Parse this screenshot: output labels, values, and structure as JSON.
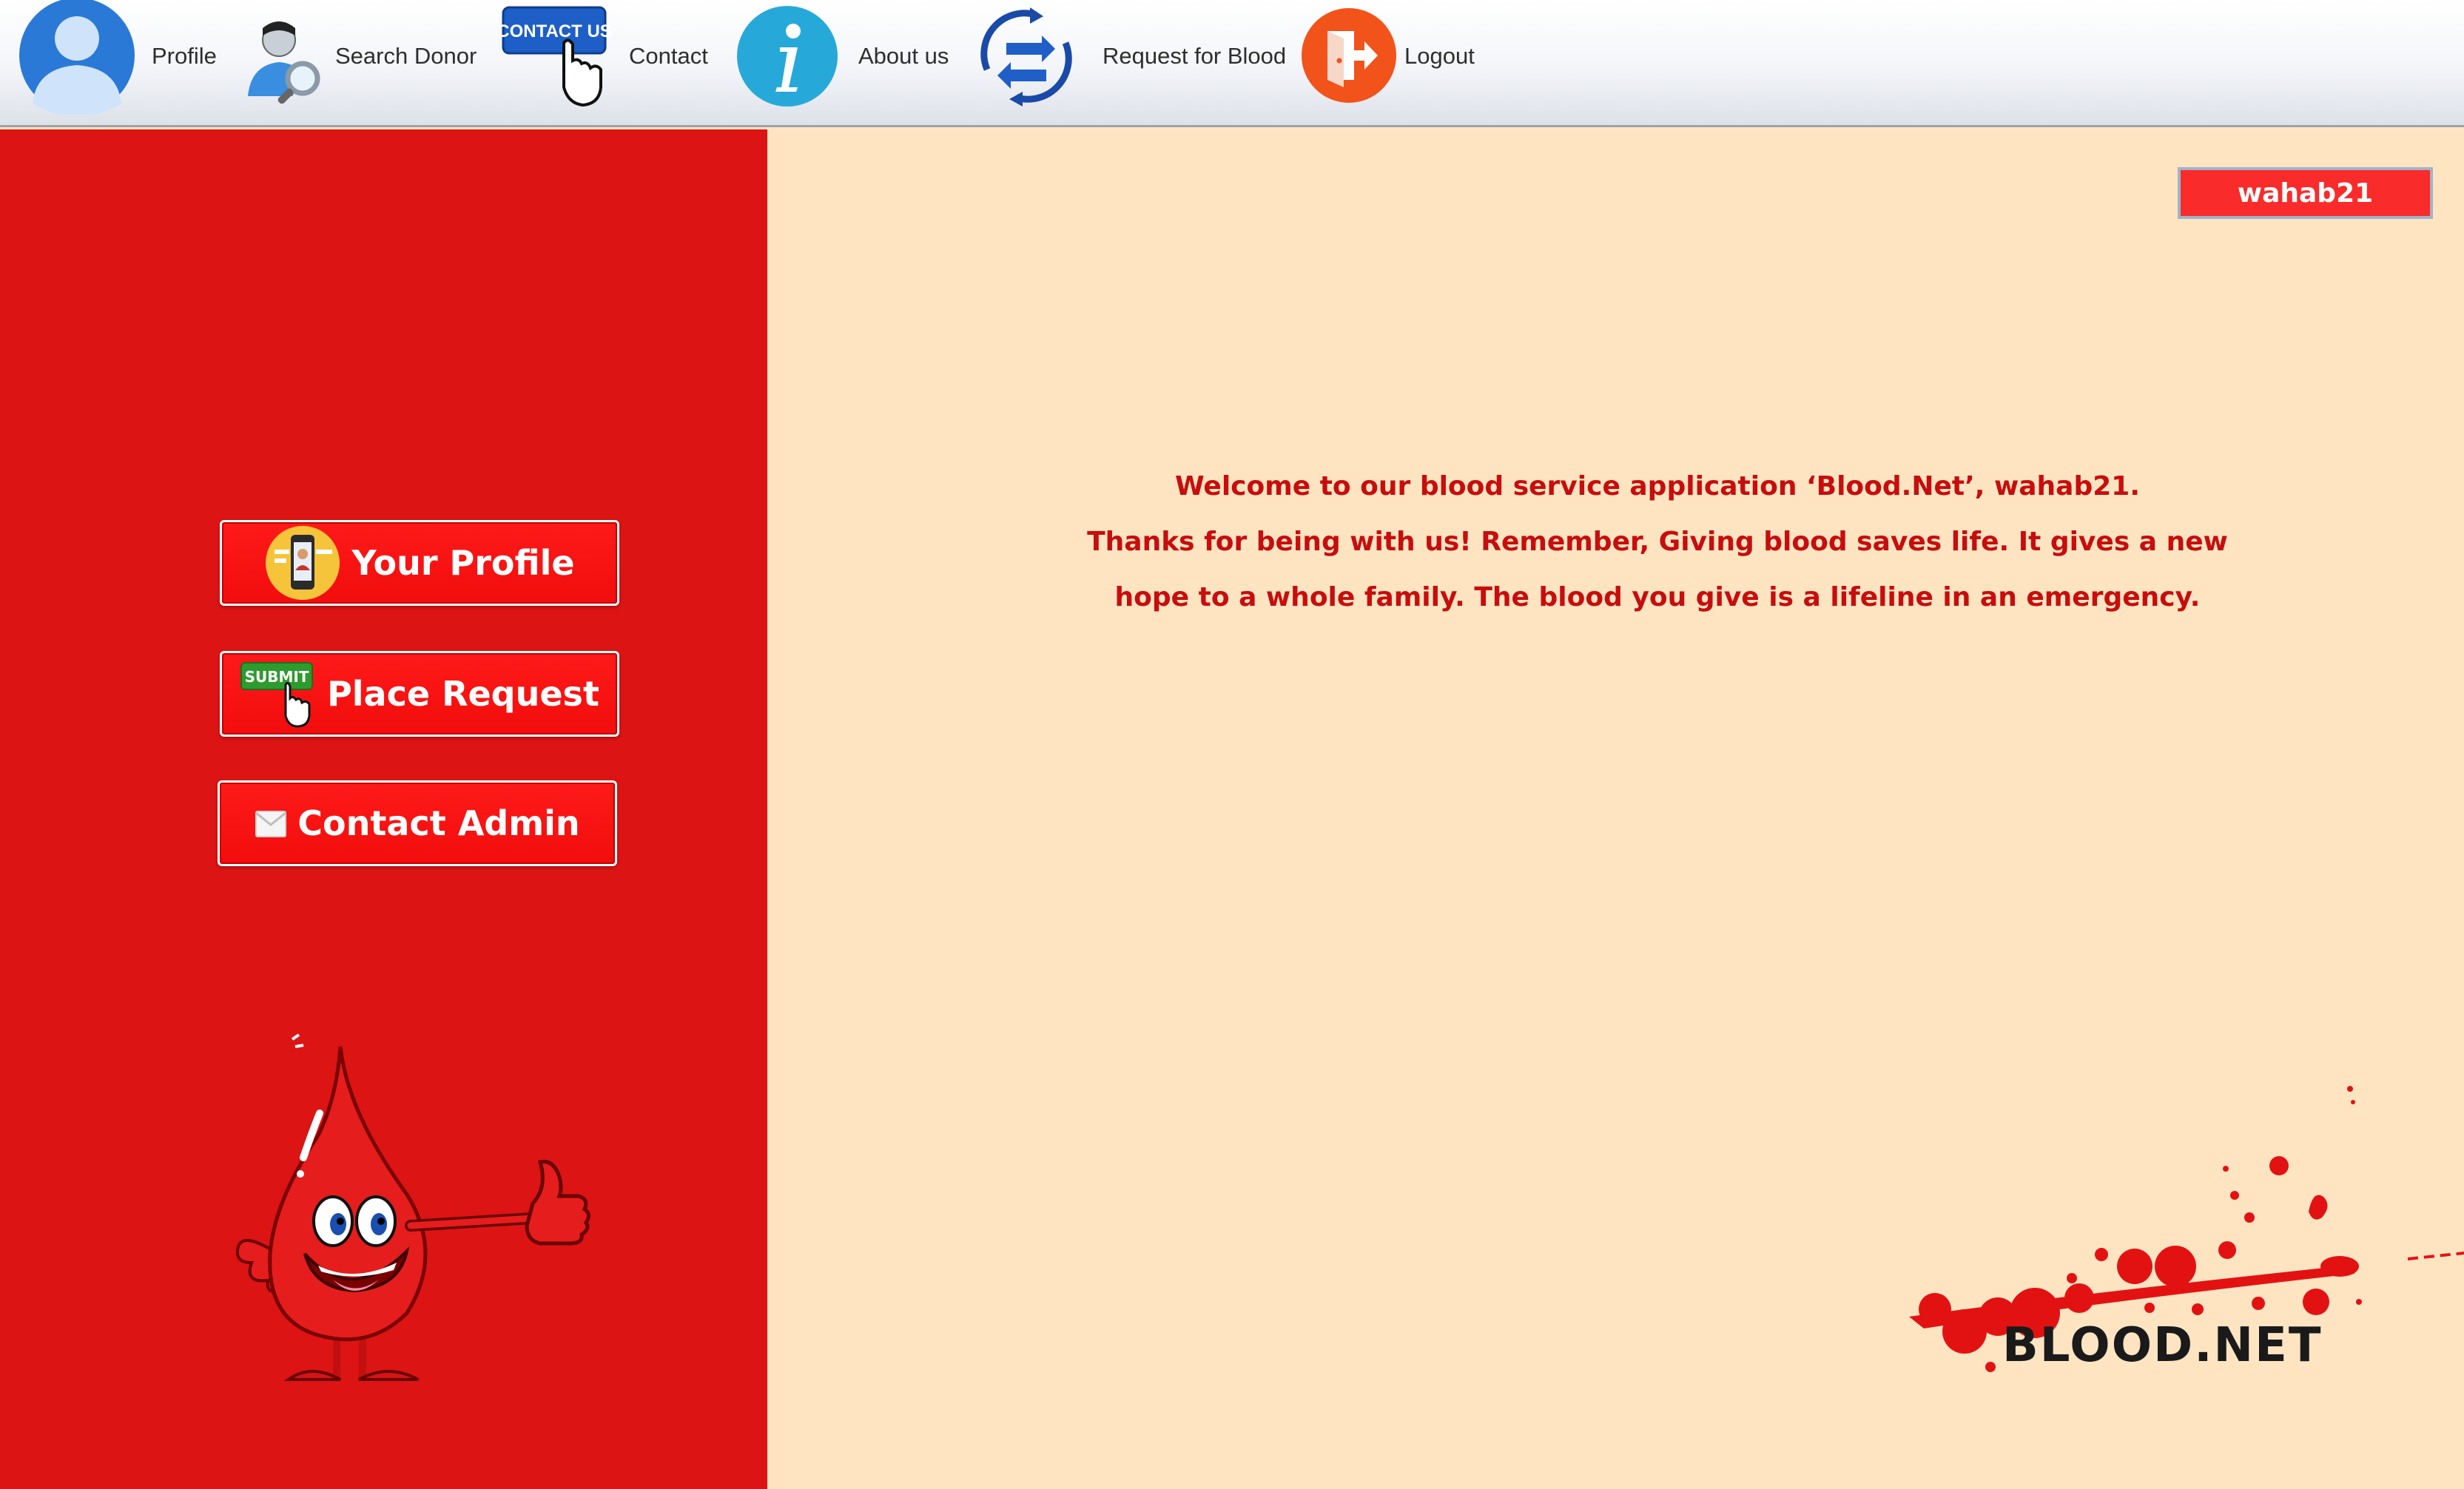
{
  "menu": {
    "profile": "Profile",
    "search_donor": "Search Donor",
    "contact_icon_text": "CONTACT US",
    "contact": "Contact",
    "about": "About us",
    "request": "Request for Blood",
    "logout": "Logout"
  },
  "sidebar": {
    "your_profile": "Your Profile",
    "submit_icon_text": "SUBMIT",
    "place_request": "Place Request",
    "contact_admin": "Contact Admin"
  },
  "user": {
    "username": "wahab21"
  },
  "welcome": {
    "line1": "Welcome to our blood service application ‘Blood.Net’, wahab21.",
    "line2": "Thanks for being with us! Remember, Giving blood saves life. It gives a new",
    "line3": "hope to a whole family. The blood you give is a lifeline in an emergency."
  },
  "logo": {
    "text": "BLOOD.NET"
  },
  "colors": {
    "sidebar_red": "#dc1414",
    "content_bg": "#ffe4c2",
    "button_red": "#f20d0d",
    "text_red": "#c70d0d"
  },
  "icons": {
    "profile": "user-silhouette-icon",
    "search_donor": "user-search-icon",
    "contact": "contact-us-button-icon",
    "about": "info-icon",
    "request": "refresh-arrows-icon",
    "logout": "exit-door-icon",
    "your_profile": "phone-profile-icon",
    "place_request": "submit-cursor-icon",
    "contact_admin": "envelope-icon"
  }
}
